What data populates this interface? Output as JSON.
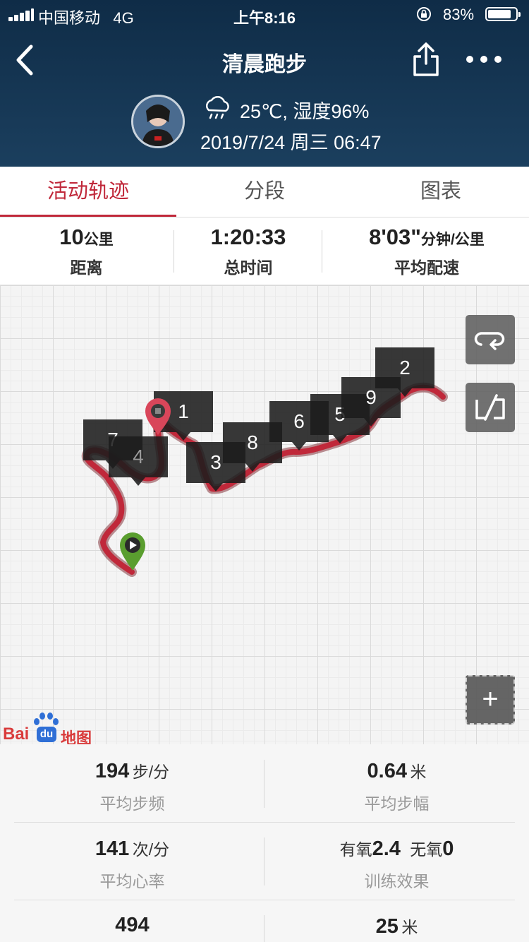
{
  "status_bar": {
    "carrier": "中国移动",
    "network": "4G",
    "time": "上午8:16",
    "battery_percent": "83%",
    "battery_level": 0.83
  },
  "header": {
    "title": "清晨跑步",
    "weather": "25℃, 湿度96%",
    "datetime": "2019/7/24 周三 06:47"
  },
  "tabs": [
    {
      "label": "活动轨迹",
      "active": true
    },
    {
      "label": "分段",
      "active": false
    },
    {
      "label": "图表",
      "active": false
    }
  ],
  "summary": {
    "distance": {
      "value": "10",
      "unit": "公里",
      "label": "距离"
    },
    "total_time": {
      "value": "1:20:33",
      "label": "总时间"
    },
    "pace": {
      "value": "8'03\"",
      "unit": "分钟/公里",
      "label": "平均配速"
    }
  },
  "map": {
    "km_markers": [
      "1",
      "2",
      "3",
      "4",
      "5",
      "6",
      "7",
      "8",
      "9"
    ],
    "track_color": "#c0283a",
    "start_marker_color": "#5a9e2f",
    "end_marker_color": "#d9465a",
    "zoom_in": "+",
    "attribution": {
      "bai": "Bai",
      "du": "du",
      "map": "地图"
    }
  },
  "stats": [
    {
      "value": "194",
      "unit": "步/分",
      "label": "平均步频"
    },
    {
      "value": "0.64",
      "unit": "米",
      "label": "平均步幅"
    },
    {
      "value": "141",
      "unit": "次/分",
      "label": "平均心率"
    },
    {
      "aerobic_label": "有氧",
      "aerobic_value": "2.4",
      "anaerobic_label": "无氧",
      "anaerobic_value": "0",
      "label": "训练效果"
    },
    {
      "value": "494",
      "unit": "",
      "label": ""
    },
    {
      "value": "25",
      "unit": "米",
      "label": ""
    }
  ]
}
